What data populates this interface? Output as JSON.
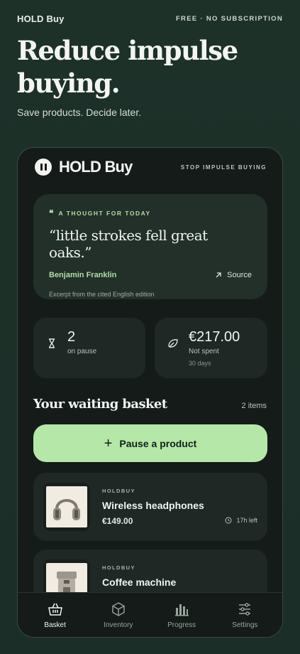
{
  "top": {
    "brand": "HOLD Buy",
    "tagline": "FREE · NO SUBSCRIPTION"
  },
  "hero": {
    "title": "Reduce impulse buying.",
    "subtitle": "Save products. Decide later."
  },
  "app": {
    "name": "HOLD Buy",
    "tagline": "STOP IMPULSE BUYING",
    "quote": {
      "kicker": "A THOUGHT FOR TODAY",
      "mark": "❝",
      "text": "“little strokes fell great oaks.”",
      "author": "Benjamin Franklin",
      "source_label": "Source",
      "note": "Excerpt from the cited English edition"
    },
    "stats": {
      "paused": {
        "value": "2",
        "label": "on pause"
      },
      "saved": {
        "value": "€217.00",
        "label": "Not spent",
        "sub": "30 days"
      }
    },
    "basket": {
      "title": "Your waiting basket",
      "count": "2 items",
      "add_label": "Pause a product",
      "items": [
        {
          "store": "HOLDBUY",
          "name": "Wireless headphones",
          "price": "€149.00",
          "time_left": "17h left"
        },
        {
          "store": "HOLDBUY",
          "name": "Coffee machine"
        }
      ]
    },
    "tabs": [
      {
        "label": "Basket",
        "icon": "basket-icon"
      },
      {
        "label": "Inventory",
        "icon": "cube-icon"
      },
      {
        "label": "Progress",
        "icon": "bar-chart-icon"
      },
      {
        "label": "Settings",
        "icon": "sliders-icon"
      }
    ],
    "colors": {
      "accent": "#b5e7a8",
      "background": "#1c2f27",
      "card": "#1f2824"
    }
  }
}
